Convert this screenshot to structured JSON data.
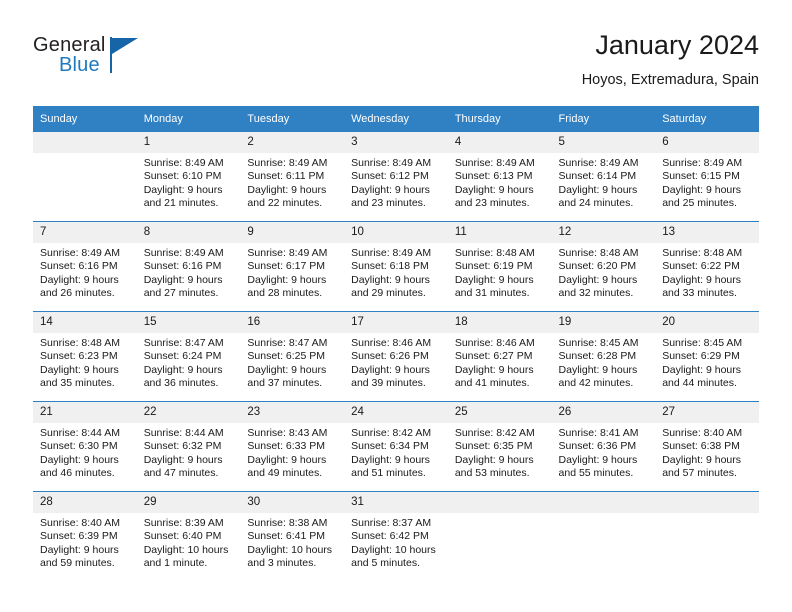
{
  "brand": {
    "name_part1": "General",
    "name_part2": "Blue",
    "flag_icon": "flag-icon"
  },
  "header": {
    "title": "January 2024",
    "subtitle": "Hoyos, Extremadura, Spain"
  },
  "colors": {
    "header_blue": "#3080c4",
    "brand_blue": "#1f7ac0",
    "daynum_bg": "#f0f0f0",
    "text": "#1a1a1a"
  },
  "weekday_headers": [
    "Sunday",
    "Monday",
    "Tuesday",
    "Wednesday",
    "Thursday",
    "Friday",
    "Saturday"
  ],
  "weeks": [
    [
      {
        "day": "",
        "sunrise": "",
        "sunset": "",
        "daylight1": "",
        "daylight2": "",
        "empty": true
      },
      {
        "day": "1",
        "sunrise": "Sunrise: 8:49 AM",
        "sunset": "Sunset: 6:10 PM",
        "daylight1": "Daylight: 9 hours",
        "daylight2": "and 21 minutes."
      },
      {
        "day": "2",
        "sunrise": "Sunrise: 8:49 AM",
        "sunset": "Sunset: 6:11 PM",
        "daylight1": "Daylight: 9 hours",
        "daylight2": "and 22 minutes."
      },
      {
        "day": "3",
        "sunrise": "Sunrise: 8:49 AM",
        "sunset": "Sunset: 6:12 PM",
        "daylight1": "Daylight: 9 hours",
        "daylight2": "and 23 minutes."
      },
      {
        "day": "4",
        "sunrise": "Sunrise: 8:49 AM",
        "sunset": "Sunset: 6:13 PM",
        "daylight1": "Daylight: 9 hours",
        "daylight2": "and 23 minutes."
      },
      {
        "day": "5",
        "sunrise": "Sunrise: 8:49 AM",
        "sunset": "Sunset: 6:14 PM",
        "daylight1": "Daylight: 9 hours",
        "daylight2": "and 24 minutes."
      },
      {
        "day": "6",
        "sunrise": "Sunrise: 8:49 AM",
        "sunset": "Sunset: 6:15 PM",
        "daylight1": "Daylight: 9 hours",
        "daylight2": "and 25 minutes."
      }
    ],
    [
      {
        "day": "7",
        "sunrise": "Sunrise: 8:49 AM",
        "sunset": "Sunset: 6:16 PM",
        "daylight1": "Daylight: 9 hours",
        "daylight2": "and 26 minutes."
      },
      {
        "day": "8",
        "sunrise": "Sunrise: 8:49 AM",
        "sunset": "Sunset: 6:16 PM",
        "daylight1": "Daylight: 9 hours",
        "daylight2": "and 27 minutes."
      },
      {
        "day": "9",
        "sunrise": "Sunrise: 8:49 AM",
        "sunset": "Sunset: 6:17 PM",
        "daylight1": "Daylight: 9 hours",
        "daylight2": "and 28 minutes."
      },
      {
        "day": "10",
        "sunrise": "Sunrise: 8:49 AM",
        "sunset": "Sunset: 6:18 PM",
        "daylight1": "Daylight: 9 hours",
        "daylight2": "and 29 minutes."
      },
      {
        "day": "11",
        "sunrise": "Sunrise: 8:48 AM",
        "sunset": "Sunset: 6:19 PM",
        "daylight1": "Daylight: 9 hours",
        "daylight2": "and 31 minutes."
      },
      {
        "day": "12",
        "sunrise": "Sunrise: 8:48 AM",
        "sunset": "Sunset: 6:20 PM",
        "daylight1": "Daylight: 9 hours",
        "daylight2": "and 32 minutes."
      },
      {
        "day": "13",
        "sunrise": "Sunrise: 8:48 AM",
        "sunset": "Sunset: 6:22 PM",
        "daylight1": "Daylight: 9 hours",
        "daylight2": "and 33 minutes."
      }
    ],
    [
      {
        "day": "14",
        "sunrise": "Sunrise: 8:48 AM",
        "sunset": "Sunset: 6:23 PM",
        "daylight1": "Daylight: 9 hours",
        "daylight2": "and 35 minutes."
      },
      {
        "day": "15",
        "sunrise": "Sunrise: 8:47 AM",
        "sunset": "Sunset: 6:24 PM",
        "daylight1": "Daylight: 9 hours",
        "daylight2": "and 36 minutes."
      },
      {
        "day": "16",
        "sunrise": "Sunrise: 8:47 AM",
        "sunset": "Sunset: 6:25 PM",
        "daylight1": "Daylight: 9 hours",
        "daylight2": "and 37 minutes."
      },
      {
        "day": "17",
        "sunrise": "Sunrise: 8:46 AM",
        "sunset": "Sunset: 6:26 PM",
        "daylight1": "Daylight: 9 hours",
        "daylight2": "and 39 minutes."
      },
      {
        "day": "18",
        "sunrise": "Sunrise: 8:46 AM",
        "sunset": "Sunset: 6:27 PM",
        "daylight1": "Daylight: 9 hours",
        "daylight2": "and 41 minutes."
      },
      {
        "day": "19",
        "sunrise": "Sunrise: 8:45 AM",
        "sunset": "Sunset: 6:28 PM",
        "daylight1": "Daylight: 9 hours",
        "daylight2": "and 42 minutes."
      },
      {
        "day": "20",
        "sunrise": "Sunrise: 8:45 AM",
        "sunset": "Sunset: 6:29 PM",
        "daylight1": "Daylight: 9 hours",
        "daylight2": "and 44 minutes."
      }
    ],
    [
      {
        "day": "21",
        "sunrise": "Sunrise: 8:44 AM",
        "sunset": "Sunset: 6:30 PM",
        "daylight1": "Daylight: 9 hours",
        "daylight2": "and 46 minutes."
      },
      {
        "day": "22",
        "sunrise": "Sunrise: 8:44 AM",
        "sunset": "Sunset: 6:32 PM",
        "daylight1": "Daylight: 9 hours",
        "daylight2": "and 47 minutes."
      },
      {
        "day": "23",
        "sunrise": "Sunrise: 8:43 AM",
        "sunset": "Sunset: 6:33 PM",
        "daylight1": "Daylight: 9 hours",
        "daylight2": "and 49 minutes."
      },
      {
        "day": "24",
        "sunrise": "Sunrise: 8:42 AM",
        "sunset": "Sunset: 6:34 PM",
        "daylight1": "Daylight: 9 hours",
        "daylight2": "and 51 minutes."
      },
      {
        "day": "25",
        "sunrise": "Sunrise: 8:42 AM",
        "sunset": "Sunset: 6:35 PM",
        "daylight1": "Daylight: 9 hours",
        "daylight2": "and 53 minutes."
      },
      {
        "day": "26",
        "sunrise": "Sunrise: 8:41 AM",
        "sunset": "Sunset: 6:36 PM",
        "daylight1": "Daylight: 9 hours",
        "daylight2": "and 55 minutes."
      },
      {
        "day": "27",
        "sunrise": "Sunrise: 8:40 AM",
        "sunset": "Sunset: 6:38 PM",
        "daylight1": "Daylight: 9 hours",
        "daylight2": "and 57 minutes."
      }
    ],
    [
      {
        "day": "28",
        "sunrise": "Sunrise: 8:40 AM",
        "sunset": "Sunset: 6:39 PM",
        "daylight1": "Daylight: 9 hours",
        "daylight2": "and 59 minutes."
      },
      {
        "day": "29",
        "sunrise": "Sunrise: 8:39 AM",
        "sunset": "Sunset: 6:40 PM",
        "daylight1": "Daylight: 10 hours",
        "daylight2": "and 1 minute."
      },
      {
        "day": "30",
        "sunrise": "Sunrise: 8:38 AM",
        "sunset": "Sunset: 6:41 PM",
        "daylight1": "Daylight: 10 hours",
        "daylight2": "and 3 minutes."
      },
      {
        "day": "31",
        "sunrise": "Sunrise: 8:37 AM",
        "sunset": "Sunset: 6:42 PM",
        "daylight1": "Daylight: 10 hours",
        "daylight2": "and 5 minutes."
      },
      {
        "day": "",
        "sunrise": "",
        "sunset": "",
        "daylight1": "",
        "daylight2": "",
        "empty": true
      },
      {
        "day": "",
        "sunrise": "",
        "sunset": "",
        "daylight1": "",
        "daylight2": "",
        "empty": true
      },
      {
        "day": "",
        "sunrise": "",
        "sunset": "",
        "daylight1": "",
        "daylight2": "",
        "empty": true
      }
    ]
  ]
}
